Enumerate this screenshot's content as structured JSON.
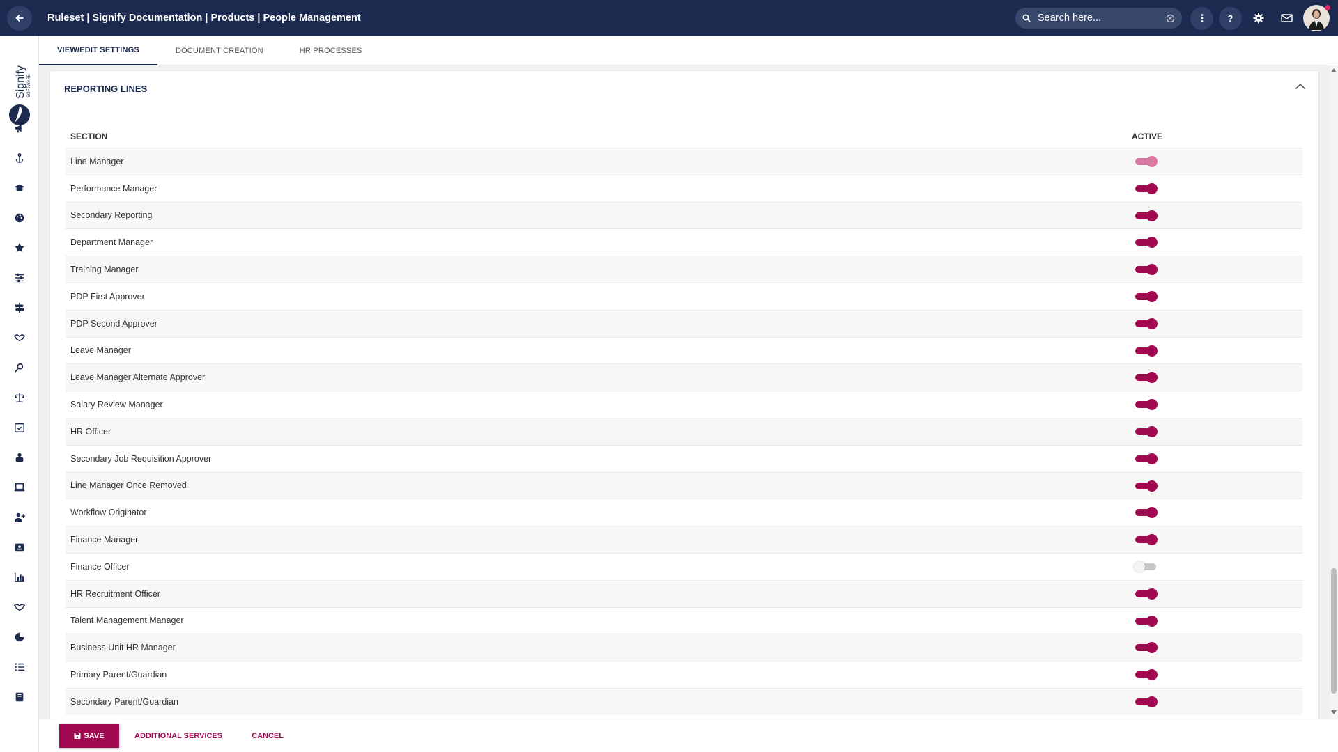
{
  "header": {
    "title": "Ruleset | Signify Documentation | Products | People Management",
    "search_placeholder": "Search here..."
  },
  "logo": {
    "brand": "Signify",
    "sub": "SOFTWARE"
  },
  "tabs": [
    {
      "label": "VIEW/EDIT SETTINGS",
      "active": true
    },
    {
      "label": "DOCUMENT CREATION",
      "active": false
    },
    {
      "label": "HR PROCESSES",
      "active": false
    }
  ],
  "card": {
    "title": "REPORTING LINES",
    "col_section": "SECTION",
    "col_active": "ACTIVE"
  },
  "rows": [
    {
      "label": "Line Manager",
      "state": "on-light"
    },
    {
      "label": "Performance Manager",
      "state": "on"
    },
    {
      "label": "Secondary Reporting",
      "state": "on"
    },
    {
      "label": "Department Manager",
      "state": "on"
    },
    {
      "label": "Training Manager",
      "state": "on"
    },
    {
      "label": "PDP First Approver",
      "state": "on"
    },
    {
      "label": "PDP Second Approver",
      "state": "on"
    },
    {
      "label": "Leave Manager",
      "state": "on"
    },
    {
      "label": "Leave Manager Alternate Approver",
      "state": "on"
    },
    {
      "label": "Salary Review Manager",
      "state": "on"
    },
    {
      "label": "HR Officer",
      "state": "on"
    },
    {
      "label": "Secondary Job Requisition Approver",
      "state": "on"
    },
    {
      "label": "Line Manager Once Removed",
      "state": "on"
    },
    {
      "label": "Workflow Originator",
      "state": "on"
    },
    {
      "label": "Finance Manager",
      "state": "on"
    },
    {
      "label": "Finance Officer",
      "state": "off"
    },
    {
      "label": "HR Recruitment Officer",
      "state": "on"
    },
    {
      "label": "Talent Management Manager",
      "state": "on"
    },
    {
      "label": "Business Unit HR Manager",
      "state": "on"
    },
    {
      "label": "Primary Parent/Guardian",
      "state": "on"
    },
    {
      "label": "Secondary Parent/Guardian",
      "state": "on"
    }
  ],
  "footer": {
    "save": "SAVE",
    "additional": "ADDITIONAL SERVICES",
    "cancel": "CANCEL"
  },
  "colors": {
    "nav": "#1b2a4e",
    "accent": "#a0094f",
    "accent_light": "#d97aa3"
  },
  "sidebar_icons": [
    "megaphone-icon",
    "anchor-icon",
    "graduation-cap-icon",
    "palette-icon",
    "star-icon",
    "sliders-icon",
    "signpost-icon",
    "handshake-icon",
    "search-person-icon",
    "balance-scale-icon",
    "calendar-check-icon",
    "people-hands-icon",
    "laptop-icon",
    "user-plus-icon",
    "id-badge-icon",
    "bar-chart-icon",
    "handshake-alt-icon",
    "pie-chart-icon",
    "list-ordered-icon",
    "book-icon"
  ]
}
